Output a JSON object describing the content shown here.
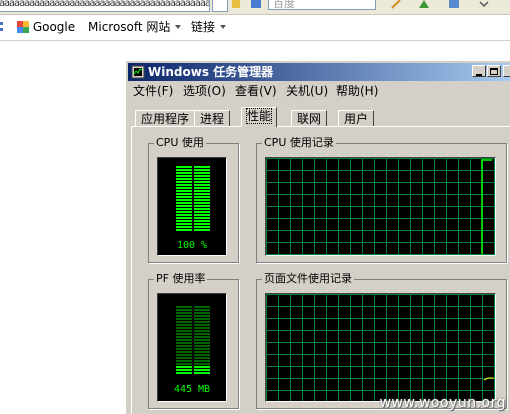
{
  "browser": {
    "address_text": "aaaaaaaaaaaaaaaaaaaaaaaaaaaaaaaaaaaaaaaaaaaaa",
    "search_placeholder": "百度",
    "links": [
      {
        "label": "Google",
        "icon": "google-icon"
      },
      {
        "label": "Microsoft 网站",
        "icon": "chevron-down-icon"
      },
      {
        "label": "链接",
        "icon": "chevron-down-icon"
      }
    ]
  },
  "window": {
    "title": "Windows 任务管理器",
    "menu": [
      "文件(F)",
      "选项(O)",
      "查看(V)",
      "关机(U)",
      "帮助(H)"
    ],
    "tabs": [
      "应用程序",
      "进程",
      "性能",
      "联网",
      "用户"
    ],
    "active_tab": "性能"
  },
  "performance": {
    "cpu_usage": {
      "label": "CPU 使用",
      "value_text": "100 %",
      "fill_percent": 100
    },
    "cpu_history": {
      "label": "CPU 使用记录"
    },
    "pf_usage": {
      "label": "PF 使用率",
      "value_text": "445 MB",
      "fill_percent": 12
    },
    "pf_history": {
      "label": "页面文件使用记录"
    }
  },
  "watermark": "www.wooyun.org",
  "colors": {
    "graph_green": "#00ff00",
    "grid_green": "#008040",
    "titlebar": "#0a246a"
  }
}
